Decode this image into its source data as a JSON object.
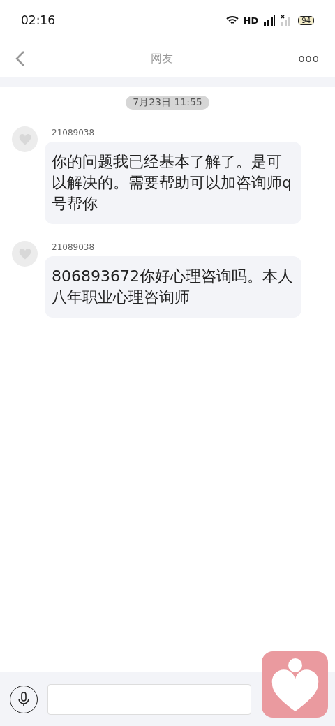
{
  "status_bar": {
    "time": "02:16",
    "network": "HD",
    "battery": "94"
  },
  "nav": {
    "title": "网友",
    "more": "ooo"
  },
  "timestamp": "7月23日 11:55",
  "messages": [
    {
      "sender": "21089038",
      "text": "你的问题我已经基本了解了。是可以解决的。需要帮助可以加咨询师q号帮你"
    },
    {
      "sender": "21089038",
      "text": "806893672你好心理咨询吗。本人八年职业心理咨询师"
    }
  ]
}
